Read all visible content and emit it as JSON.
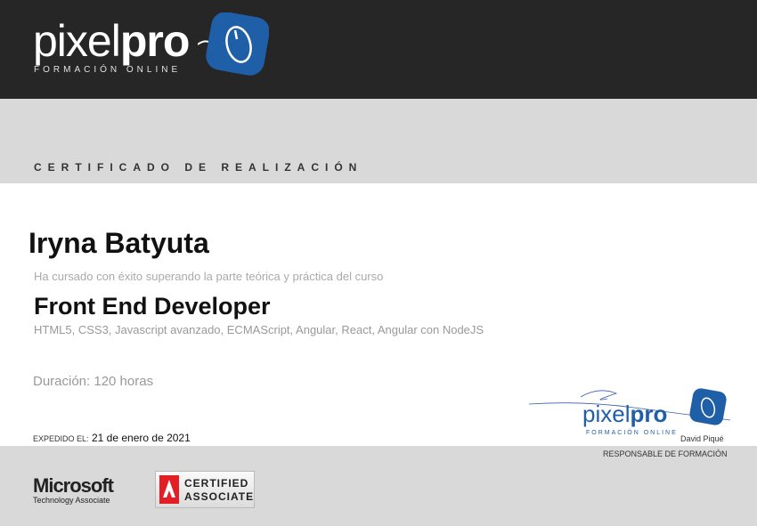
{
  "header": {
    "logo_word_light": "pixel",
    "logo_word_bold": "pro",
    "logo_subtitle": "FORMACIÓN ONLINE"
  },
  "certificate": {
    "title": "CERTIFICADO DE REALIZACIÓN",
    "recipient_name": "Iryna Batyuta",
    "intro_text": "Ha cursado con éxito superando la parte teórica y práctica del curso",
    "course_name": "Front End Developer",
    "course_topics": "HTML5, CSS3, Javascript avanzado, ECMAScript, Angular, React, Angular con NodeJS",
    "duration": "Duración: 120 horas",
    "issued_label": "EXPEDIDO EL:",
    "issued_date": "21 de enero de 2021"
  },
  "signature": {
    "logo_word_light": "pixel",
    "logo_word_bold": "pro",
    "logo_subtitle": "FORMACIÓN ONLINE",
    "signer_name": "David Piqué",
    "signer_role": "RESPONSABLE DE FORMACIÓN"
  },
  "badges": {
    "microsoft_word": "Microsoft",
    "microsoft_sub": "Technology Associate",
    "adobe_line1": "CERTIFIED",
    "adobe_line2": "ASSOCIATE"
  },
  "colors": {
    "header_bg": "#262626",
    "band_bg": "#d9d9d9",
    "brand_blue": "#1f5fa8"
  },
  "icons": {
    "logo": "mouse-icon",
    "adobe": "adobe-logo-icon"
  }
}
